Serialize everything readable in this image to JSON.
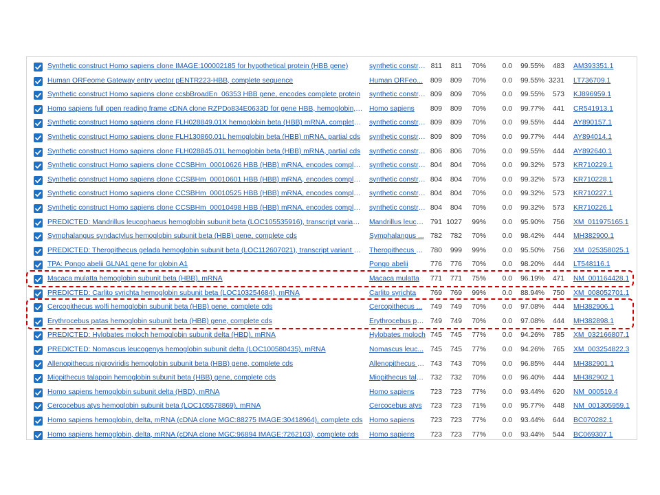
{
  "results": [
    {
      "description": "Synthetic construct Homo sapiens clone IMAGE:100002185 for hypothetical protein (HBB gene)",
      "scientific_name": "synthetic construct",
      "max_score": "811",
      "total_score": "811",
      "query_cover": "70%",
      "e_value": "0.0",
      "per_ident": "99.55%",
      "acc_len": "483",
      "accession": "AM393351.1",
      "checked": true
    },
    {
      "description": "Human ORFeome Gateway entry vector pENTR223-HBB, complete sequence",
      "scientific_name": "Human ORFeo...",
      "max_score": "809",
      "total_score": "809",
      "query_cover": "70%",
      "e_value": "0.0",
      "per_ident": "99.55%",
      "acc_len": "3231",
      "accession": "LT736709.1",
      "checked": true
    },
    {
      "description": "Synthetic construct Homo sapiens clone ccsbBroadEn_06353 HBB gene, encodes complete protein",
      "scientific_name": "synthetic construct",
      "max_score": "809",
      "total_score": "809",
      "query_cover": "70%",
      "e_value": "0.0",
      "per_ident": "99.55%",
      "acc_len": "573",
      "accession": "KJ896959.1",
      "checked": true
    },
    {
      "description": "Homo sapiens full open reading frame cDNA clone RZPDo834E0633D for gene HBB, hemoglobin, beta; co...",
      "scientific_name": "Homo sapiens",
      "max_score": "809",
      "total_score": "809",
      "query_cover": "70%",
      "e_value": "0.0",
      "per_ident": "99.77%",
      "acc_len": "441",
      "accession": "CR541913.1",
      "checked": true
    },
    {
      "description": "Synthetic construct Homo sapiens clone FLH028849.01X hemoglobin beta (HBB) mRNA, complete cds",
      "scientific_name": "synthetic construct",
      "max_score": "809",
      "total_score": "809",
      "query_cover": "70%",
      "e_value": "0.0",
      "per_ident": "99.55%",
      "acc_len": "444",
      "accession": "AY890157.1",
      "checked": true
    },
    {
      "description": "Synthetic construct Homo sapiens clone FLH130860.01L hemoglobin beta (HBB) mRNA, partial cds",
      "scientific_name": "synthetic construct",
      "max_score": "809",
      "total_score": "809",
      "query_cover": "70%",
      "e_value": "0.0",
      "per_ident": "99.77%",
      "acc_len": "444",
      "accession": "AY894014.1",
      "checked": true
    },
    {
      "description": "Synthetic construct Homo sapiens clone FLH028845.01L hemoglobin beta (HBB) mRNA, partial cds",
      "scientific_name": "synthetic construct",
      "max_score": "806",
      "total_score": "806",
      "query_cover": "70%",
      "e_value": "0.0",
      "per_ident": "99.55%",
      "acc_len": "444",
      "accession": "AY892640.1",
      "checked": true
    },
    {
      "description": "Synthetic construct Homo sapiens clone CCSBHm_00010626 HBB (HBB) mRNA, encodes complete protein",
      "scientific_name": "synthetic construct",
      "max_score": "804",
      "total_score": "804",
      "query_cover": "70%",
      "e_value": "0.0",
      "per_ident": "99.32%",
      "acc_len": "573",
      "accession": "KR710229.1",
      "checked": true
    },
    {
      "description": "Synthetic construct Homo sapiens clone CCSBHm_00010601 HBB (HBB) mRNA, encodes complete protein",
      "scientific_name": "synthetic construct",
      "max_score": "804",
      "total_score": "804",
      "query_cover": "70%",
      "e_value": "0.0",
      "per_ident": "99.32%",
      "acc_len": "573",
      "accession": "KR710228.1",
      "checked": true
    },
    {
      "description": "Synthetic construct Homo sapiens clone CCSBHm_00010525 HBB (HBB) mRNA, encodes complete protein",
      "scientific_name": "synthetic construct",
      "max_score": "804",
      "total_score": "804",
      "query_cover": "70%",
      "e_value": "0.0",
      "per_ident": "99.32%",
      "acc_len": "573",
      "accession": "KR710227.1",
      "checked": true
    },
    {
      "description": "Synthetic construct Homo sapiens clone CCSBHm_00010498 HBB (HBB) mRNA, encodes complete protein",
      "scientific_name": "synthetic construct",
      "max_score": "804",
      "total_score": "804",
      "query_cover": "70%",
      "e_value": "0.0",
      "per_ident": "99.32%",
      "acc_len": "573",
      "accession": "KR710226.1",
      "checked": true
    },
    {
      "description": "PREDICTED: Mandrillus leucophaeus hemoglobin subunit beta (LOC105535916), transcript variant X1, mR...",
      "scientific_name": "Mandrillus leuco...",
      "max_score": "791",
      "total_score": "1027",
      "query_cover": "99%",
      "e_value": "0.0",
      "per_ident": "95.90%",
      "acc_len": "756",
      "accession": "XM_011975165.1",
      "checked": true
    },
    {
      "description": "Symphalangus syndactylus hemoglobin subunit beta (HBB) gene, complete cds",
      "scientific_name": "Symphalangus ...",
      "max_score": "782",
      "total_score": "782",
      "query_cover": "70%",
      "e_value": "0.0",
      "per_ident": "98.42%",
      "acc_len": "444",
      "accession": "MH382900.1",
      "checked": true
    },
    {
      "description": "PREDICTED: Theropithecus gelada hemoglobin subunit beta (LOC112607021), transcript variant X1, mRNA",
      "scientific_name": "Theropithecus g...",
      "max_score": "780",
      "total_score": "999",
      "query_cover": "99%",
      "e_value": "0.0",
      "per_ident": "95.50%",
      "acc_len": "756",
      "accession": "XM_025358025.1",
      "checked": true
    },
    {
      "description": "TPA: Pongo abelii GLNA1 gene for globin A1",
      "scientific_name": "Pongo abelii",
      "max_score": "776",
      "total_score": "776",
      "query_cover": "70%",
      "e_value": "0.0",
      "per_ident": "98.20%",
      "acc_len": "444",
      "accession": "LT548116.1",
      "checked": true
    },
    {
      "description": "Macaca mulatta hemoglobin subunit beta (HBB), mRNA",
      "scientific_name": "Macaca mulatta",
      "max_score": "771",
      "total_score": "771",
      "query_cover": "75%",
      "e_value": "0.0",
      "per_ident": "96.19%",
      "acc_len": "471",
      "accession": "NM_001164428.1",
      "checked": true
    },
    {
      "description": "PREDICTED: Carlito syrichta hemoglobin subunit beta (LOC103254684), mRNA",
      "scientific_name": "Carlito syrichta",
      "max_score": "769",
      "total_score": "769",
      "query_cover": "99%",
      "e_value": "0.0",
      "per_ident": "88.94%",
      "acc_len": "750",
      "accession": "XM_008052701.1",
      "checked": true
    },
    {
      "description": "Cercopithecus wolfi hemoglobin subunit beta (HBB) gene, complete cds",
      "scientific_name": "Cercopithecus ...",
      "max_score": "749",
      "total_score": "749",
      "query_cover": "70%",
      "e_value": "0.0",
      "per_ident": "97.08%",
      "acc_len": "444",
      "accession": "MH382906.1",
      "checked": true
    },
    {
      "description": "Erythrocebus patas hemoglobin subunit beta (HBB) gene, complete cds",
      "scientific_name": "Erythrocebus pa...",
      "max_score": "749",
      "total_score": "749",
      "query_cover": "70%",
      "e_value": "0.0",
      "per_ident": "97.08%",
      "acc_len": "444",
      "accession": "MH382898.1",
      "checked": true
    },
    {
      "description": "PREDICTED: Hylobates moloch hemoglobin subunit delta (HBD), mRNA",
      "scientific_name": "Hylobates moloch",
      "max_score": "745",
      "total_score": "745",
      "query_cover": "77%",
      "e_value": "0.0",
      "per_ident": "94.26%",
      "acc_len": "785",
      "accession": "XM_032166807.1",
      "checked": true
    },
    {
      "description": "PREDICTED: Nomascus leucogenys hemoglobin subunit delta (LOC100580435), mRNA",
      "scientific_name": "Nomascus leuc...",
      "max_score": "745",
      "total_score": "745",
      "query_cover": "77%",
      "e_value": "0.0",
      "per_ident": "94.26%",
      "acc_len": "765",
      "accession": "XM_003254822.3",
      "checked": true
    },
    {
      "description": "Allenopithecus nigroviridis hemoglobin subunit beta (HBB) gene, complete cds",
      "scientific_name": "Allenopithecus n...",
      "max_score": "743",
      "total_score": "743",
      "query_cover": "70%",
      "e_value": "0.0",
      "per_ident": "96.85%",
      "acc_len": "444",
      "accession": "MH382901.1",
      "checked": true
    },
    {
      "description": "Miopithecus talapoin hemoglobin subunit beta (HBB) gene, complete cds",
      "scientific_name": "Miopithecus tala...",
      "max_score": "732",
      "total_score": "732",
      "query_cover": "70%",
      "e_value": "0.0",
      "per_ident": "96.40%",
      "acc_len": "444",
      "accession": "MH382902.1",
      "checked": true
    },
    {
      "description": "Homo sapiens hemoglobin subunit delta (HBD), mRNA",
      "scientific_name": "Homo sapiens",
      "max_score": "723",
      "total_score": "723",
      "query_cover": "77%",
      "e_value": "0.0",
      "per_ident": "93.44%",
      "acc_len": "620",
      "accession": "NM_000519.4",
      "checked": true
    },
    {
      "description": "Cercocebus atys hemoglobin subunit beta (LOC105578869), mRNA",
      "scientific_name": "Cercocebus atys",
      "max_score": "723",
      "total_score": "723",
      "query_cover": "71%",
      "e_value": "0.0",
      "per_ident": "95.77%",
      "acc_len": "448",
      "accession": "NM_001305959.1",
      "checked": true
    },
    {
      "description": "Homo sapiens hemoglobin, delta, mRNA (cDNA clone MGC:88275 IMAGE:30418964), complete cds",
      "scientific_name": "Homo sapiens",
      "max_score": "723",
      "total_score": "723",
      "query_cover": "77%",
      "e_value": "0.0",
      "per_ident": "93.44%",
      "acc_len": "644",
      "accession": "BC070282.1",
      "checked": true
    },
    {
      "description": "Homo sapiens hemoglobin, delta, mRNA (cDNA clone MGC:96894 IMAGE:7262103), complete cds",
      "scientific_name": "Homo sapiens",
      "max_score": "723",
      "total_score": "723",
      "query_cover": "77%",
      "e_value": "0.0",
      "per_ident": "93.44%",
      "acc_len": "544",
      "accession": "BC069307.1",
      "checked": true
    }
  ],
  "highlights": [
    {
      "rows": [
        15
      ]
    },
    {
      "rows": [
        17,
        18
      ]
    }
  ],
  "colors": {
    "link": "#1a57b5",
    "checkbox": "#1f6fc2",
    "highlight_border": "#cc0000",
    "text": "#333333"
  },
  "icons": {
    "checkbox": "checkbox-checked-icon"
  }
}
